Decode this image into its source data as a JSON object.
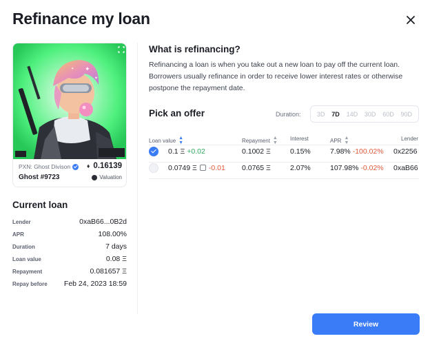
{
  "modal": {
    "title": "Refinance my loan",
    "close_icon": "close-icon"
  },
  "nft": {
    "collection": "PXN: Ghost Divison",
    "name": "Ghost #9723",
    "price": "0.16139",
    "price_icon": "eth-icon",
    "valuation_label": "Valuation",
    "expand_icon": "expand-icon"
  },
  "current_loan": {
    "title": "Current loan",
    "rows": [
      {
        "label": "Lender",
        "value": "0xaB66...0B2d"
      },
      {
        "label": "APR",
        "value": "108.00%"
      },
      {
        "label": "Duration",
        "value": "7 days"
      },
      {
        "label": "Loan value",
        "value": "0.08 Ξ"
      },
      {
        "label": "Repayment",
        "value": "0.081657 Ξ"
      },
      {
        "label": "Repay before",
        "value": "Feb 24, 2023 18:59"
      }
    ]
  },
  "info": {
    "title": "What is refinancing?",
    "text": "Refinancing a loan is when you take out a new loan to pay off the current loan. Borrowers usually refinance in order to receive lower interest rates or otherwise postpone the repayment date."
  },
  "offers": {
    "title": "Pick an offer",
    "duration_label": "Duration:",
    "durations": [
      "3D",
      "7D",
      "14D",
      "30D",
      "60D",
      "90D"
    ],
    "selected_duration": "7D",
    "columns": [
      "Loan value",
      "Repayment",
      "Interest",
      "APR",
      "Lender"
    ],
    "rows": [
      {
        "selected": true,
        "loan_value": "0.1 Ξ",
        "loan_delta": "+0.02",
        "repayment": "0.1002 Ξ",
        "interest": "0.15%",
        "apr": "7.98%",
        "apr_delta": "-100.02%",
        "lender": "0x2256"
      },
      {
        "selected": false,
        "loan_value": "0.0749 Ξ",
        "loan_delta": "-0.01",
        "repayment": "0.0765 Ξ",
        "interest": "2.07%",
        "apr": "107.98%",
        "apr_delta": "-0.02%",
        "lender": "0xaB66"
      }
    ]
  },
  "footer": {
    "review_label": "Review"
  },
  "colors": {
    "accent": "#3a7bf7",
    "positive": "#2eaa5a",
    "negative": "#e0593a",
    "nft_bg": "#4cf07a"
  }
}
